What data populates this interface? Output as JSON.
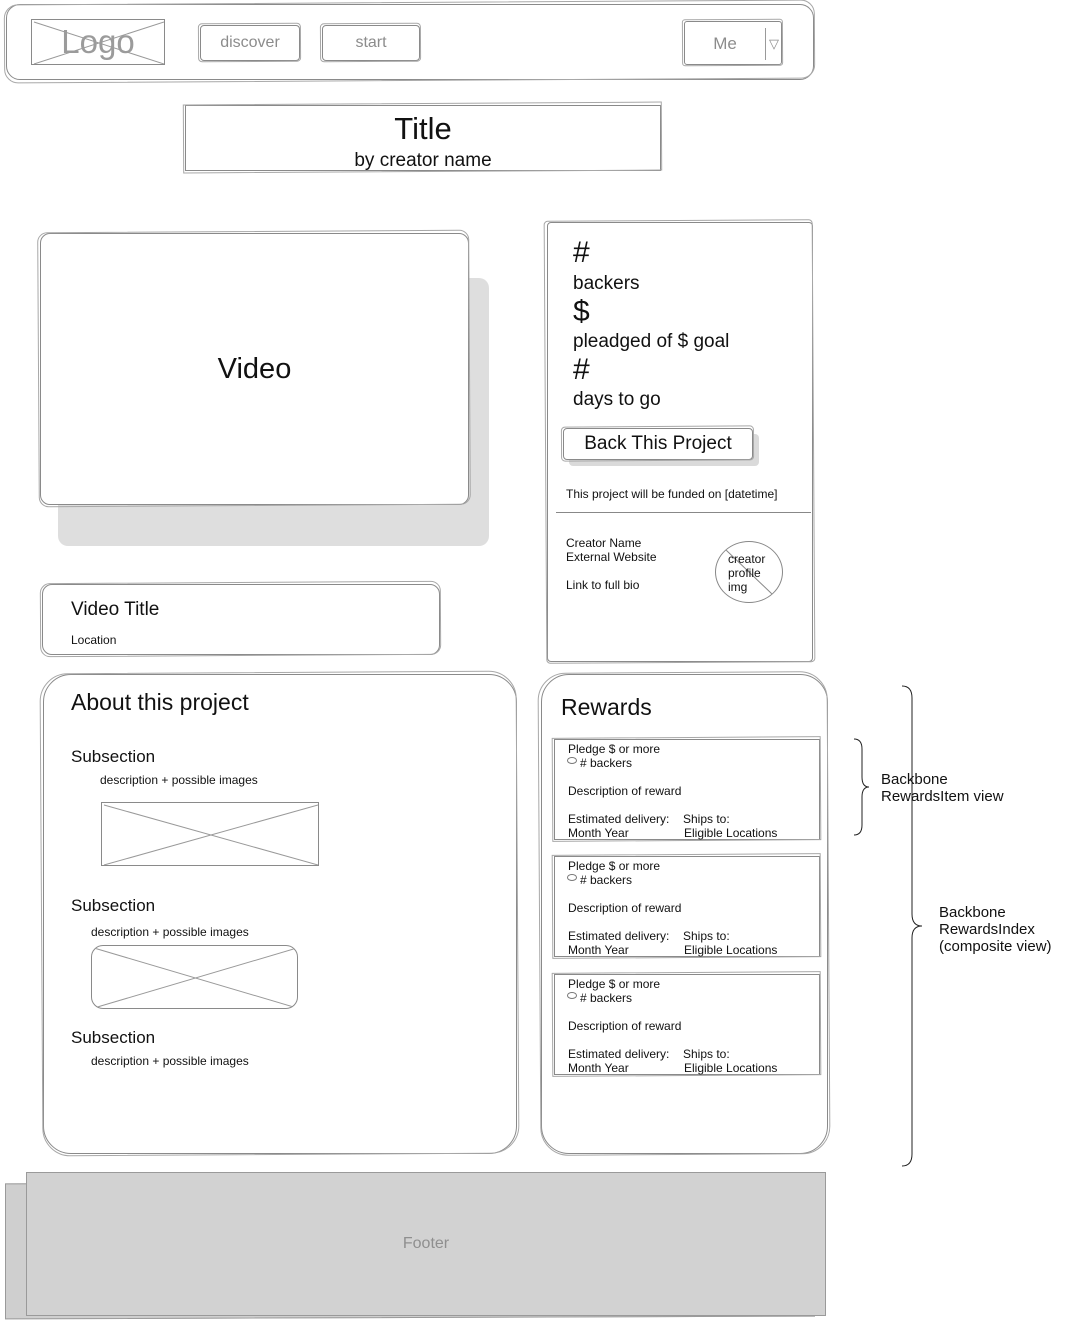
{
  "header": {
    "logo_text": "Logo",
    "nav": {
      "discover": "discover",
      "start": "start"
    },
    "user_menu": {
      "label": "Me",
      "arrow": "▽"
    }
  },
  "project": {
    "title": "Title",
    "byline": "by creator name"
  },
  "video": {
    "placeholder": "Video",
    "title": "Video Title",
    "location": "Location"
  },
  "stats": {
    "backers_symbol": "#",
    "backers_label": "backers",
    "pledged_symbol": "$",
    "pledged_label": "pleadged of $ goal",
    "days_symbol": "#",
    "days_label": "days to go",
    "back_button": "Back This Project",
    "funded_note": "This project will be funded on [datetime]",
    "creator_name": "Creator Name",
    "external_website": "External Website",
    "bio_link": "Link to full bio",
    "profile_img_lines": [
      "creator",
      "profile",
      "img"
    ]
  },
  "about": {
    "heading": "About this project",
    "subsections": [
      {
        "title": "Subsection",
        "description": "description + possible images"
      },
      {
        "title": "Subsection",
        "description": "description + possible images"
      },
      {
        "title": "Subsection",
        "description": "description + possible images"
      }
    ]
  },
  "rewards": {
    "heading": "Rewards",
    "items": [
      {
        "pledge": "Pledge $ or more",
        "backers": "# backers",
        "description": "Description of reward",
        "delivery_label": "Estimated delivery:",
        "delivery_value": "Month Year",
        "ships_label": "Ships to:",
        "ships_value": "Eligible Locations"
      },
      {
        "pledge": "Pledge $ or more",
        "backers": "# backers",
        "description": "Description of reward",
        "delivery_label": "Estimated delivery:",
        "delivery_value": "Month Year",
        "ships_label": "Ships to:",
        "ships_value": "Eligible Locations"
      },
      {
        "pledge": "Pledge $ or more",
        "backers": "# backers",
        "description": "Description of reward",
        "delivery_label": "Estimated delivery:",
        "delivery_value": "Month Year",
        "ships_label": "Ships to:",
        "ships_value": "Eligible Locations"
      }
    ]
  },
  "annotations": {
    "rewards_item": [
      "Backbone",
      "RewardsItem view"
    ],
    "rewards_index": [
      "Backbone",
      "RewardsIndex",
      "(composite view)"
    ]
  },
  "footer": {
    "label": "Footer"
  }
}
